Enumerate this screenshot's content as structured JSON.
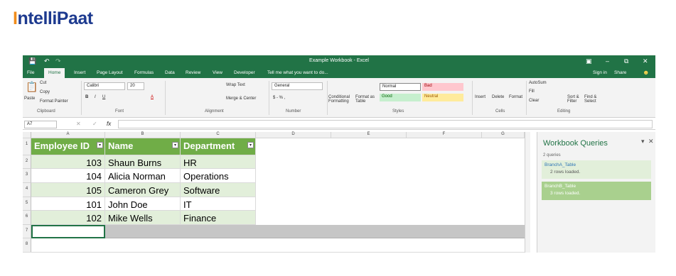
{
  "logo": {
    "prefix": "I",
    "text": "ntelliPaat"
  },
  "window": {
    "title": "Example Workbook - Excel",
    "sign_in": "Sign in",
    "share": "Share"
  },
  "menu": {
    "file": "File",
    "home": "Home",
    "insert": "Insert",
    "page_layout": "Page Layout",
    "formulas": "Formulas",
    "data": "Data",
    "review": "Review",
    "view": "View",
    "developer": "Developer",
    "tell_me": "Tell me what you want to do..."
  },
  "clipboard": {
    "paste": "Paste",
    "cut": "Cut",
    "copy": "Copy",
    "format_painter": "Format Painter",
    "label": "Clipboard"
  },
  "font": {
    "name": "Calibri",
    "size": "20",
    "label": "Font"
  },
  "alignment": {
    "wrap_text": "Wrap Text",
    "merge_center": "Merge & Center",
    "label": "Alignment"
  },
  "number": {
    "format": "General",
    "label": "Number"
  },
  "styles": {
    "conditional": "Conditional Formatting",
    "format_as_table": "Format as Table",
    "normal": "Normal",
    "bad": "Bad",
    "good": "Good",
    "neutral": "Neutral",
    "label": "Styles"
  },
  "cells": {
    "insert": "Insert",
    "delete": "Delete",
    "format": "Format",
    "label": "Cells"
  },
  "editing": {
    "autosum": "AutoSum",
    "fill": "Fill",
    "clear": "Clear",
    "sort_filter": "Sort & Filter",
    "find_select": "Find & Select",
    "label": "Editing"
  },
  "formula_bar": {
    "name_box": "A7",
    "fx": "fx"
  },
  "columns": [
    "A",
    "B",
    "C",
    "D",
    "E",
    "F",
    "G"
  ],
  "rows": [
    "1",
    "2",
    "3",
    "4",
    "5",
    "6",
    "7",
    "8"
  ],
  "table": {
    "headers": [
      "Employee ID",
      "Name",
      "Department"
    ],
    "rows": [
      [
        "103",
        "Shaun Burns",
        "HR"
      ],
      [
        "104",
        "Alicia Norman",
        "Operations"
      ],
      [
        "105",
        "Cameron Grey",
        "Software"
      ],
      [
        "101",
        "John Doe",
        "IT"
      ],
      [
        "102",
        "Mike Wells",
        "Finance"
      ]
    ]
  },
  "queries": {
    "title": "Workbook Queries",
    "count": "2 queries",
    "items": [
      {
        "name": "BranchA_Table",
        "status": "2 rows loaded."
      },
      {
        "name": "BranchB_Table",
        "status": "3 rows loaded."
      }
    ]
  },
  "colors": {
    "excel_green": "#217346",
    "header_green": "#70ad47",
    "band_green": "#e2efda"
  }
}
